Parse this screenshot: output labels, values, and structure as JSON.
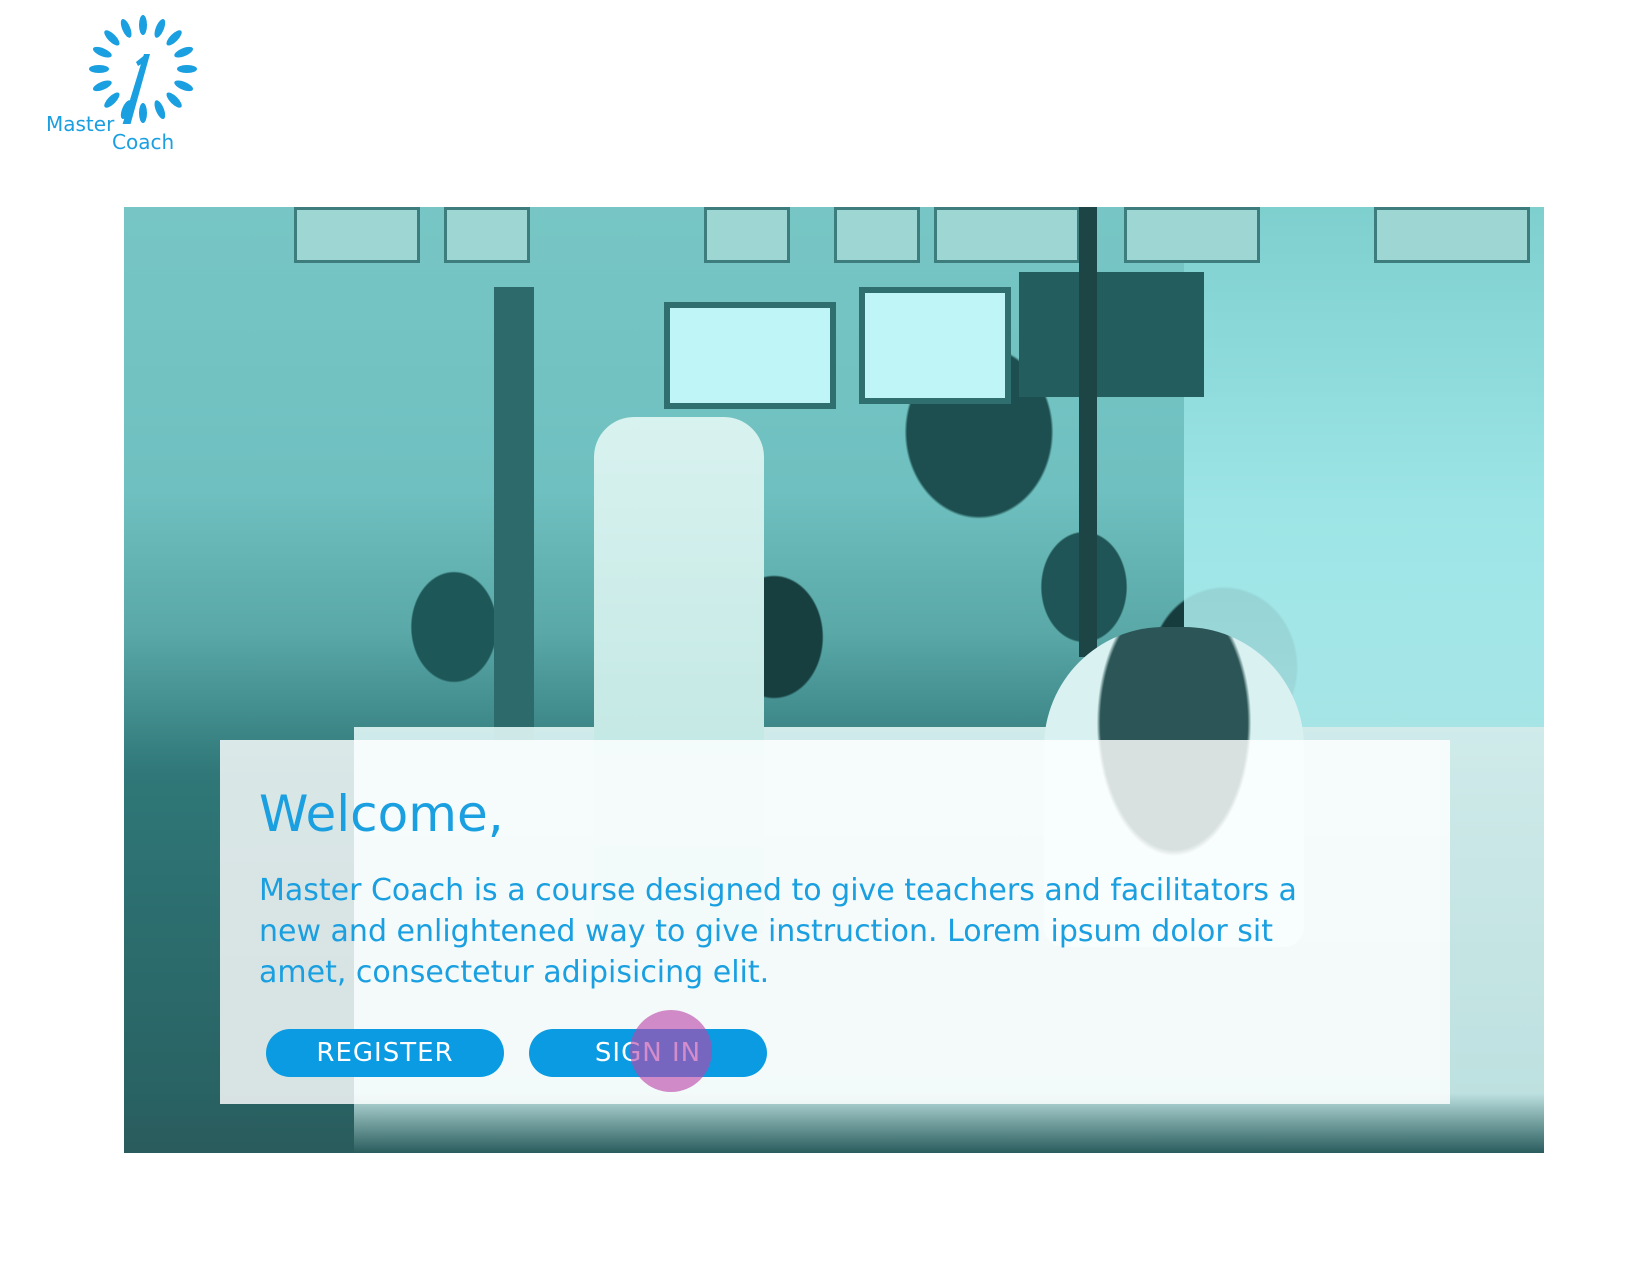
{
  "brand": {
    "logo_word_1": "Master",
    "logo_word_2": "Coach",
    "accent_color": "#1a9fe0"
  },
  "welcome": {
    "title": "Welcome,",
    "body": "Master Coach is a course designed to give teachers and facilitators a new and enlightened way to give instruction. Lorem ipsum dolor sit amet, consectetur adipisicing elit."
  },
  "actions": {
    "register_label": "REGISTER",
    "signin_label": "SIGN IN",
    "button_color": "#0a9be2",
    "tap_indicator_color": "#b946aa"
  },
  "hero": {
    "image_icon": "classroom-photo"
  }
}
